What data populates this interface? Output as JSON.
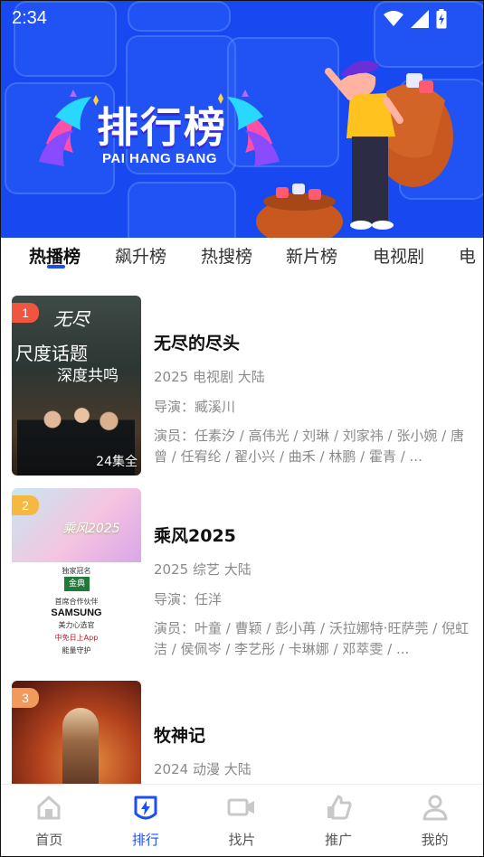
{
  "status": {
    "time": "2:34"
  },
  "banner": {
    "title": "排行榜",
    "subtitle": "PAI HANG BANG"
  },
  "tabs": [
    {
      "label": "热播榜",
      "active": true
    },
    {
      "label": "飙升榜"
    },
    {
      "label": "热搜榜"
    },
    {
      "label": "新片榜"
    },
    {
      "label": "电视剧"
    },
    {
      "label": "电"
    }
  ],
  "items": [
    {
      "rank": "1",
      "rank_color": "#f0563f",
      "name": "无尽的尽头",
      "meta": "2025 电视剧 大陆",
      "director": "导演：臧溪川",
      "actors": "演员：任素汐 / 高伟光 / 刘琳 / 刘家祎 / 张小婉 / 唐曾 / 任宥纶 / 翟小兴 / 曲禾 / 林鹏 / 霍青 / ...",
      "episodes": "24集全",
      "poster_text_1": "尺度话题",
      "poster_text_2": "深度共鸣"
    },
    {
      "rank": "2",
      "rank_color": "#f5b942",
      "name": "乘风2025",
      "meta": "2025 综艺 大陆",
      "director": "导演：任洋",
      "actors": "演员：叶童 / 曹颖 / 彭小苒 / 沃拉娜特·旺萨莞 / 倪虹洁 / 侯佩岑 / 李艺彤 / 卡琳娜 / 邓萃雯 / ...",
      "poster_brand_1": "独家冠名",
      "poster_brand_2": "金典",
      "poster_brand_3": "首席合作伙伴",
      "poster_brand_4": "SAMSUNG",
      "poster_brand_5": "美力心选官",
      "poster_brand_6": "中免日上App",
      "poster_brand_7": "能量守护",
      "poster_title": "乘风2025"
    },
    {
      "rank": "3",
      "rank_color": "#f19a5b",
      "name": "牧神记",
      "meta": "2024 动漫 大陆"
    }
  ],
  "nav": [
    {
      "label": "首页",
      "icon": "home-icon"
    },
    {
      "label": "排行",
      "icon": "ranking-icon",
      "active": true
    },
    {
      "label": "找片",
      "icon": "video-camera-icon"
    },
    {
      "label": "推广",
      "icon": "thumbs-up-icon"
    },
    {
      "label": "我的",
      "icon": "user-icon"
    }
  ],
  "colors": {
    "accent": "#1d4ef5",
    "banner": "#1748f0"
  }
}
